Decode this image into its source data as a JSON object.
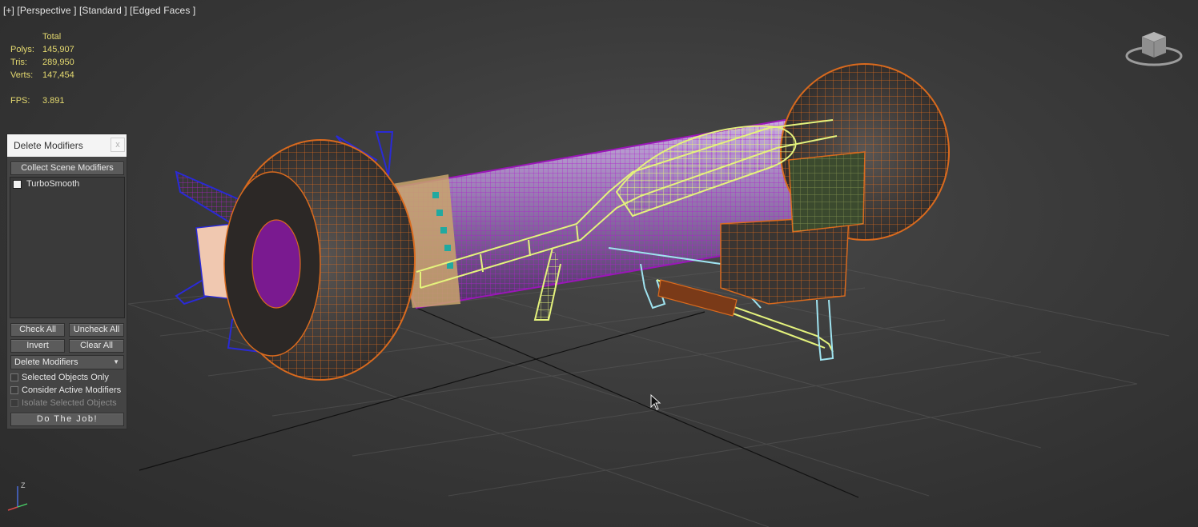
{
  "viewport": {
    "label": "[+] [Perspective ] [Standard ] [Edged Faces ]"
  },
  "stats": {
    "header": "Total",
    "polys_label": "Polys:",
    "polys": "145,907",
    "tris_label": "Tris:",
    "tris": "289,950",
    "verts_label": "Verts:",
    "verts": "147,454",
    "fps_label": "FPS:",
    "fps": "3.891"
  },
  "dialog": {
    "title": "Delete Modifiers",
    "close": "x",
    "collect_label": "Collect Scene Modifiers",
    "modifiers": [
      {
        "name": "TurboSmooth",
        "checked": false
      }
    ],
    "check_all": "Check All",
    "uncheck_all": "Uncheck All",
    "invert": "Invert",
    "clear_all": "Clear All",
    "mode": "Delete Modifiers",
    "opt_selected_only": "Selected Objects Only",
    "opt_consider_active": "Consider Active Modifiers",
    "opt_isolate": "Isolate Selected Objects",
    "do_job": "Do The Job!"
  },
  "gizmo": {
    "z_label": "Z"
  },
  "colors": {
    "wire_orange": "#d96a1e",
    "wire_purple": "#9a16b8",
    "wire_yellow": "#e4f27c",
    "wire_cyan": "#9fe3f0",
    "wire_blue": "#2a2ad6",
    "stats_yellow": "#e4d96f"
  }
}
